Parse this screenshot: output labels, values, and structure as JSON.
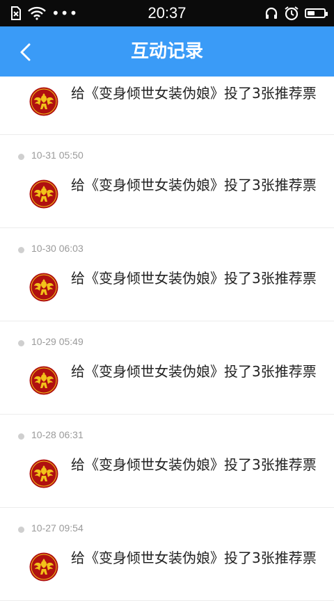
{
  "status_bar": {
    "time": "20:37",
    "dots": "•••",
    "battery_level": 0.45
  },
  "header": {
    "title": "互动记录",
    "back_label": "<"
  },
  "entries": [
    {
      "time": "",
      "message": "给《变身倾世女装伪娘》投了3张推荐票"
    },
    {
      "time": "10-31 05:50",
      "message": "给《变身倾世女装伪娘》投了3张推荐票"
    },
    {
      "time": "10-30 06:03",
      "message": "给《变身倾世女装伪娘》投了3张推荐票"
    },
    {
      "time": "10-29 05:49",
      "message": "给《变身倾世女装伪娘》投了3张推荐票"
    },
    {
      "time": "10-28 06:31",
      "message": "给《变身倾世女装伪娘》投了3张推荐票"
    },
    {
      "time": "10-27 09:54",
      "message": "给《变身倾世女装伪娘》投了3张推荐票"
    }
  ],
  "colors": {
    "header": "#3a9bf7",
    "status_bar": "#0b0b0b",
    "avatar_red": "#b01010",
    "avatar_gold": "#f2c21a"
  }
}
